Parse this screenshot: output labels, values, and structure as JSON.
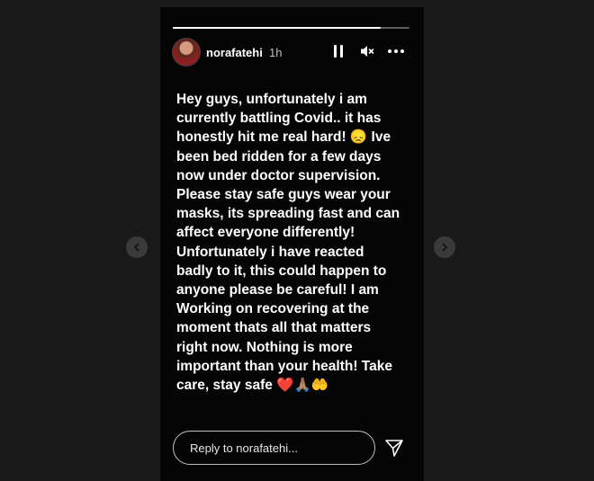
{
  "story": {
    "username": "norafatehi",
    "time_ago": "1h",
    "progress": 0.88,
    "text": "Hey guys, unfortunately i am\ncurrently battling Covid.. it has\nhonestly hit me real hard! 😞 Ive\nbeen bed ridden for a few days\nnow under doctor supervision.\nPlease stay safe guys wear your\nmasks, its spreading fast and can\naffect everyone differently!\nUnfortunately i have reacted\nbadly to it, this could happen to\nanyone please be careful! I am\nWorking on recovering at the\nmoment thats all that matters\nright now. Nothing is more\nimportant than your health! Take\ncare, stay safe  ❤️🙏🏽🤲"
  },
  "reply": {
    "placeholder": "Reply to norafatehi..."
  },
  "icons": {
    "pause": "pause-icon",
    "mute": "muted-speaker-icon",
    "more": "more-options-icon",
    "send": "send-icon",
    "prev": "chevron-left-icon",
    "next": "chevron-right-icon"
  },
  "colors": {
    "background": "#1a1a1a",
    "story_background": "#050505",
    "text": "#ffffff"
  }
}
